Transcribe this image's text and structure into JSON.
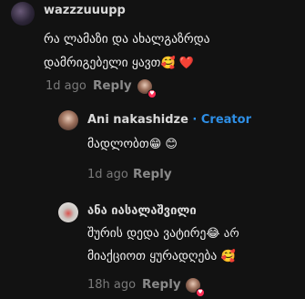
{
  "comments": [
    {
      "username": "wazzzuuupp",
      "text_line1": "რა ლამაზი და ახალგაზრდა",
      "text_line2": "დამრიგებელი ყავთ",
      "emojis": "🥰 ❤️",
      "time": "1d ago",
      "reply_label": "Reply"
    },
    {
      "username": "Ani nakashidze",
      "creator_label": "· Creator",
      "text": "მადლობთ",
      "emojis": "😁 😊",
      "time": "1d ago",
      "reply_label": "Reply"
    },
    {
      "username": "ანა იასალაშვილი",
      "text_line1": "შურის დედა ვატირე",
      "line1_tail": "😂  არ",
      "text_line2": "მიაქციოთ ყურადღება",
      "emojis": "🥰",
      "time": "18h ago",
      "reply_label": "Reply"
    }
  ],
  "colors": {
    "background": "#121212",
    "creator": "#2e8fe6",
    "heart": "#ff2d55"
  },
  "icons": [
    "avatar",
    "creator-liked-heart-icon"
  ]
}
